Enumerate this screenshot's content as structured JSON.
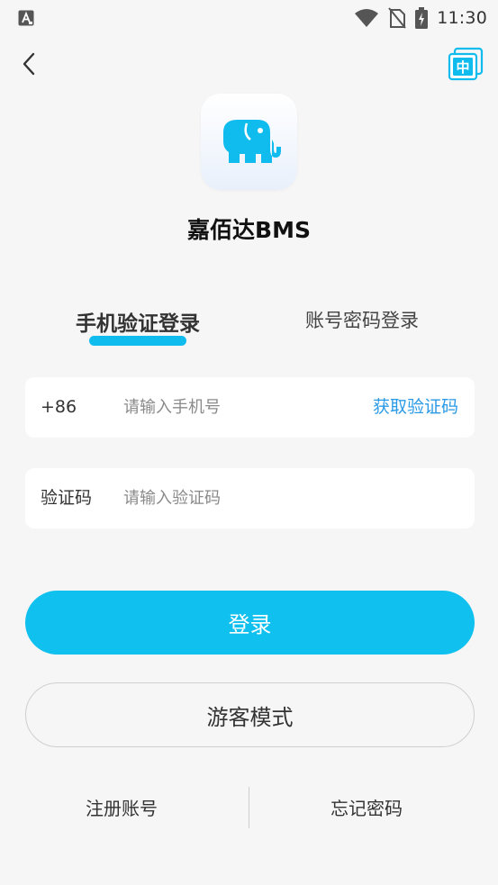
{
  "status_bar": {
    "time": "11:30",
    "app_icon": "a-letter-icon",
    "icons": [
      "wifi-icon",
      "no-sim-icon",
      "battery-charging-icon"
    ]
  },
  "nav": {
    "back_icon": "chevron-left-icon",
    "language_icon": "language-switch-icon",
    "language_label": "中"
  },
  "app": {
    "name": "嘉佰达BMS",
    "logo_icon": "elephant-icon"
  },
  "tabs": [
    {
      "label": "手机验证登录",
      "active": true
    },
    {
      "label": "账号密码登录",
      "active": false
    }
  ],
  "phone_field": {
    "prefix": "+86",
    "placeholder": "请输入手机号",
    "value": "",
    "get_code_label": "获取验证码"
  },
  "code_field": {
    "label": "验证码",
    "placeholder": "请输入验证码",
    "value": ""
  },
  "buttons": {
    "login": "登录",
    "guest": "游客模式"
  },
  "links": {
    "register": "注册账号",
    "forgot": "忘记密码"
  },
  "colors": {
    "accent": "#10c0ee",
    "link": "#2b9ae6",
    "background": "#f6f6f6"
  }
}
